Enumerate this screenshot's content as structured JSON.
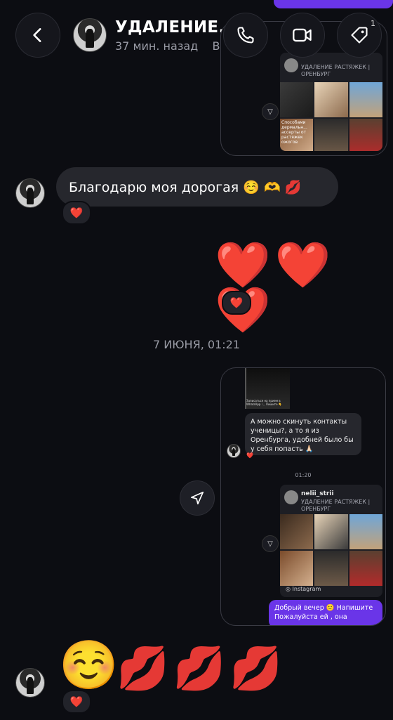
{
  "header": {
    "title": "УДАЛЕНИЕ...",
    "subtitle": "37 мин. назад",
    "subtitle_clip": "В",
    "tag_badge": "1",
    "back_icon": "chevron-left-icon",
    "call_icon": "phone-icon",
    "video_icon": "video-camera-icon",
    "tag_icon": "tag-icon"
  },
  "top_share": {
    "bio": "УДАЛЕНИЕ РАСТЯЖЕК | ОРЕНБУРГ",
    "cell_caption": "Способами дермальн... ассерты от растяжек ожогов"
  },
  "messages": {
    "thanks_text": "Благодарю моя дорогая ☺️ 🫶 💋",
    "thanks_reaction": "❤️",
    "hearts": "❤️❤️❤️",
    "hearts_reaction": "❤️",
    "date_divider": "7 ИЮНЯ, 01:21",
    "last_emoji": "☺️",
    "last_kisses": "💋💋💋",
    "last_reaction": "❤️"
  },
  "share2": {
    "small_caption": "Записаться на прием в WhatsApp 📞 Пишите 👇",
    "question": "А можно скинуть контакты ученицы?, а то я из Оренбурга, удобней было бы у себя попасть 🙏🏻",
    "question_reaction": "❤️",
    "time": "01:20",
    "username": "nelii_strii",
    "bio": "УДАЛЕНИЕ РАСТЯЖЕК | ОРЕНБУРГ",
    "instagram_label": "Instagram",
    "reply": "Добрый вечер 🙂 Напишите Пожалуйста ей , она"
  },
  "colors": {
    "accent": "#6a35e8",
    "bubble": "#26272d",
    "background": "#0c0d12"
  }
}
